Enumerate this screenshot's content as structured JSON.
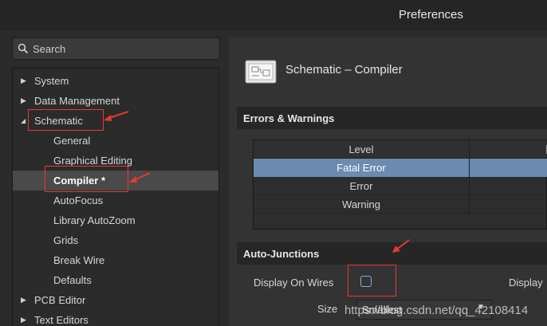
{
  "window": {
    "title": "Preferences"
  },
  "search": {
    "placeholder": "Search"
  },
  "tree": [
    {
      "label": "System",
      "level": 0,
      "expanded": false
    },
    {
      "label": "Data Management",
      "level": 0,
      "expanded": false
    },
    {
      "label": "Schematic",
      "level": 0,
      "expanded": true
    },
    {
      "label": "General",
      "level": 1
    },
    {
      "label": "Graphical Editing",
      "level": 1
    },
    {
      "label": "Compiler *",
      "level": 1,
      "selected": true
    },
    {
      "label": "AutoFocus",
      "level": 1
    },
    {
      "label": "Library AutoZoom",
      "level": 1
    },
    {
      "label": "Grids",
      "level": 1
    },
    {
      "label": "Break Wire",
      "level": 1
    },
    {
      "label": "Defaults",
      "level": 1
    },
    {
      "label": "PCB Editor",
      "level": 0,
      "expanded": false
    },
    {
      "label": "Text Editors",
      "level": 0,
      "expanded": false
    }
  ],
  "page": {
    "title": "Schematic – Compiler",
    "icon": "schematic-page-icon"
  },
  "errors_warnings": {
    "title": "Errors & Warnings",
    "column_header": "Level",
    "rows": [
      "Fatal Error",
      "Error",
      "Warning"
    ],
    "selected_row": "Fatal Error"
  },
  "auto_junctions": {
    "title": "Auto-Junctions",
    "display_on_wires_label": "Display On Wires",
    "display_on_wires_checked": false,
    "display_right_label": "Display",
    "size_label": "Size",
    "size_value": "Smallest"
  },
  "watermark": "https://blog.csdn.net/qq_42108414",
  "colors": {
    "selection": "#6b8bb0",
    "annotation": "#e53935",
    "background": "#2b2b2b"
  }
}
